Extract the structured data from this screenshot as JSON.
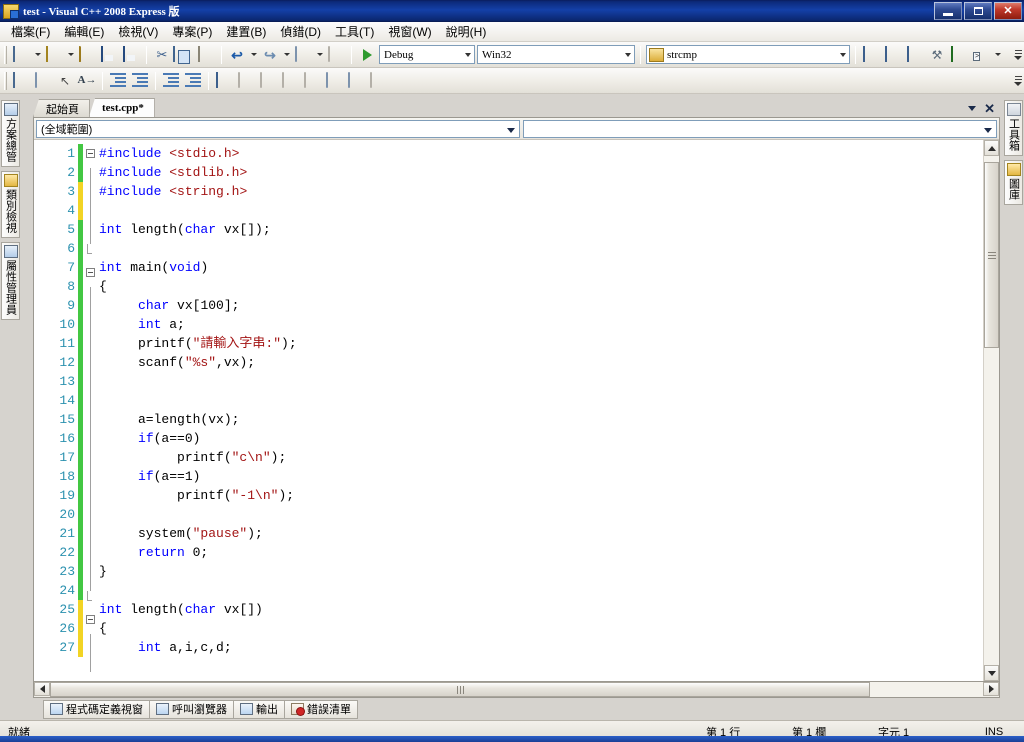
{
  "window": {
    "title": "test - Visual C++ 2008 Express 版",
    "icon": "vs-app-icon",
    "minimize_label": "最小化",
    "restore_label": "還原",
    "close_label": "關閉"
  },
  "menubar": {
    "items": [
      {
        "label": "檔案(F)",
        "name": "menu-file"
      },
      {
        "label": "編輯(E)",
        "name": "menu-edit"
      },
      {
        "label": "檢視(V)",
        "name": "menu-view"
      },
      {
        "label": "專案(P)",
        "name": "menu-project"
      },
      {
        "label": "建置(B)",
        "name": "menu-build"
      },
      {
        "label": "偵錯(D)",
        "name": "menu-debug"
      },
      {
        "label": "工具(T)",
        "name": "menu-tools"
      },
      {
        "label": "視窗(W)",
        "name": "menu-window"
      },
      {
        "label": "說明(H)",
        "name": "menu-help"
      }
    ]
  },
  "toolbar_standard": {
    "configuration": "Debug",
    "platform": "Win32",
    "find_value": "strcmp",
    "buttons": [
      {
        "name": "new-project-button",
        "icon": "new-project-icon"
      },
      {
        "name": "add-new-item-button",
        "icon": "add-item-icon"
      },
      {
        "name": "open-file-button",
        "icon": "open-folder-icon"
      },
      {
        "name": "save-button",
        "icon": "save-icon"
      },
      {
        "name": "save-all-button",
        "icon": "save-all-icon"
      },
      {
        "name": "cut-button",
        "icon": "scissors-icon"
      },
      {
        "name": "copy-button",
        "icon": "copy-icon"
      },
      {
        "name": "paste-button",
        "icon": "paste-icon"
      },
      {
        "name": "undo-button",
        "icon": "undo-icon"
      },
      {
        "name": "redo-button",
        "icon": "redo-icon"
      },
      {
        "name": "navigate-backward-button",
        "icon": "nav-back-icon"
      },
      {
        "name": "navigate-forward-button",
        "icon": "nav-forward-icon"
      },
      {
        "name": "start-debugging-button",
        "icon": "play-icon"
      },
      {
        "name": "solution-explorer-button",
        "icon": "solution-explorer-icon"
      },
      {
        "name": "properties-window-button",
        "icon": "properties-icon"
      },
      {
        "name": "object-browser-button",
        "icon": "object-browser-icon"
      },
      {
        "name": "toolbox-button",
        "icon": "toolbox-icon"
      },
      {
        "name": "error-list-button",
        "icon": "error-list-icon"
      },
      {
        "name": "command-window-button",
        "icon": "command-window-icon"
      }
    ]
  },
  "toolbar_text_editor": {
    "buttons": [
      {
        "name": "display-object-member-list-button",
        "icon": "member-list-icon"
      },
      {
        "name": "display-parameter-info-button",
        "icon": "parameter-info-icon"
      },
      {
        "name": "display-quick-info-button",
        "icon": "quick-info-icon"
      },
      {
        "name": "complete-word-button",
        "icon": "complete-word-icon"
      },
      {
        "name": "decrease-indent-button",
        "icon": "outdent-icon"
      },
      {
        "name": "increase-indent-button",
        "icon": "indent-icon"
      },
      {
        "name": "comment-selection-button",
        "icon": "comment-icon"
      },
      {
        "name": "uncomment-selection-button",
        "icon": "uncomment-icon"
      },
      {
        "name": "toggle-bookmark-button",
        "icon": "bookmark-icon"
      },
      {
        "name": "previous-bookmark-button",
        "icon": "bookmark-prev-icon"
      },
      {
        "name": "next-bookmark-button",
        "icon": "bookmark-next-icon"
      },
      {
        "name": "previous-bookmark-folder-button",
        "icon": "bookmark-folder-prev-icon"
      },
      {
        "name": "next-bookmark-folder-button",
        "icon": "bookmark-folder-next-icon"
      },
      {
        "name": "previous-bookmark-doc-button",
        "icon": "bookmark-doc-prev-icon"
      },
      {
        "name": "next-bookmark-doc-button",
        "icon": "bookmark-doc-next-icon"
      },
      {
        "name": "clear-bookmarks-button",
        "icon": "bookmark-clear-icon"
      }
    ]
  },
  "left_dock": {
    "tabs": [
      {
        "label": "方案總管",
        "name": "sidebar-tab-solution-explorer",
        "icon": "solution-explorer-icon"
      },
      {
        "label": "類別檢視",
        "name": "sidebar-tab-class-view",
        "icon": "class-view-icon"
      },
      {
        "label": "屬性管理員",
        "name": "sidebar-tab-property-manager",
        "icon": "property-manager-icon"
      }
    ]
  },
  "right_dock": {
    "tabs": [
      {
        "label": "工具箱",
        "name": "sidebar-tab-toolbox",
        "icon": "toolbox-icon"
      },
      {
        "label": "圖庫",
        "name": "sidebar-tab-gallery",
        "icon": "gallery-icon"
      }
    ]
  },
  "document_tabs": {
    "tabs": [
      {
        "label": "起始頁",
        "name": "tab-start-page",
        "active": false
      },
      {
        "label": "test.cpp*",
        "name": "tab-test-cpp",
        "active": true
      }
    ],
    "dropdown_label": "作用中檔案",
    "close_label": "關閉"
  },
  "navbar": {
    "scope": "(全域範圍)",
    "member": ""
  },
  "editor": {
    "lines": [
      {
        "n": "1",
        "change": "green",
        "fold": "open",
        "text": "#include <stdio.h>"
      },
      {
        "n": "2",
        "change": "green",
        "fold": "bar",
        "text": "#include <stdlib.h>"
      },
      {
        "n": "3",
        "change": "yellow",
        "fold": "bar",
        "text": "#include <string.h>"
      },
      {
        "n": "4",
        "change": "yellow",
        "fold": "bar",
        "text": ""
      },
      {
        "n": "5",
        "change": "green",
        "fold": "bar",
        "text": "int length(char vx[]);"
      },
      {
        "n": "6",
        "change": "green",
        "fold": "end",
        "text": ""
      },
      {
        "n": "7",
        "change": "green",
        "fold": "open",
        "text": "int main(void)"
      },
      {
        "n": "8",
        "change": "green",
        "fold": "bar",
        "text": "{"
      },
      {
        "n": "9",
        "change": "green",
        "fold": "bar",
        "text": "     char vx[100];"
      },
      {
        "n": "10",
        "change": "green",
        "fold": "bar",
        "text": "     int a;"
      },
      {
        "n": "11",
        "change": "green",
        "fold": "bar",
        "text": "     printf(\"請輸入字串:\");"
      },
      {
        "n": "12",
        "change": "green",
        "fold": "bar",
        "text": "     scanf(\"%s\",vx);"
      },
      {
        "n": "13",
        "change": "green",
        "fold": "bar",
        "text": ""
      },
      {
        "n": "14",
        "change": "green",
        "fold": "bar",
        "text": ""
      },
      {
        "n": "15",
        "change": "green",
        "fold": "bar",
        "text": "     a=length(vx);"
      },
      {
        "n": "16",
        "change": "green",
        "fold": "bar",
        "text": "     if(a==0)"
      },
      {
        "n": "17",
        "change": "green",
        "fold": "bar",
        "text": "          printf(\"c\\n\");"
      },
      {
        "n": "18",
        "change": "green",
        "fold": "bar",
        "text": "     if(a==1)"
      },
      {
        "n": "19",
        "change": "green",
        "fold": "bar",
        "text": "          printf(\"-1\\n\");"
      },
      {
        "n": "20",
        "change": "green",
        "fold": "bar",
        "text": ""
      },
      {
        "n": "21",
        "change": "green",
        "fold": "bar",
        "text": "     system(\"pause\");"
      },
      {
        "n": "22",
        "change": "green",
        "fold": "bar",
        "text": "     return 0;"
      },
      {
        "n": "23",
        "change": "green",
        "fold": "bar",
        "text": "}"
      },
      {
        "n": "24",
        "change": "green",
        "fold": "end",
        "text": ""
      },
      {
        "n": "25",
        "change": "yellow",
        "fold": "open",
        "text": "int length(char vx[])"
      },
      {
        "n": "26",
        "change": "yellow",
        "fold": "bar",
        "text": "{"
      },
      {
        "n": "27",
        "change": "yellow",
        "fold": "bar",
        "text": "     int a,i,c,d;"
      }
    ]
  },
  "bottom_tabs": {
    "tabs": [
      {
        "label": "程式碼定義視窗",
        "name": "bottom-tab-code-definition-window",
        "icon": "code-definition-icon"
      },
      {
        "label": "呼叫瀏覽器",
        "name": "bottom-tab-call-browser",
        "icon": "call-browser-icon"
      },
      {
        "label": "輸出",
        "name": "bottom-tab-output",
        "icon": "output-icon"
      },
      {
        "label": "錯誤清單",
        "name": "bottom-tab-error-list",
        "icon": "error-list-icon"
      }
    ]
  },
  "statusbar": {
    "status": "就緒",
    "line": "第 1 行",
    "column": "第 1 欄",
    "character": "字元 1",
    "insert_mode": "INS"
  },
  "colors": {
    "titlebar_blue": "#0c2a7a",
    "keyword_blue": "#0000ff",
    "string_red": "#a31515",
    "linenum_teal": "#2b91af",
    "change_saved_green": "#43c743",
    "change_unsaved_yellow": "#f2d424",
    "close_button_red": "#c0392b"
  }
}
